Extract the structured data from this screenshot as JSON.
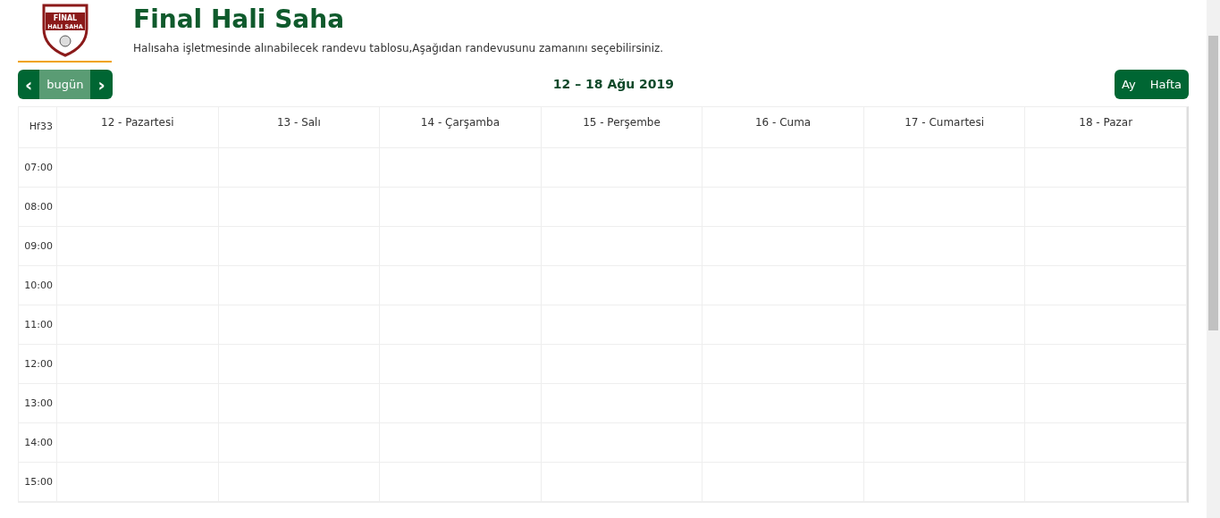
{
  "logo": {
    "line_1": "FİNAL",
    "line_2": "HALI SAHA"
  },
  "title": "Final Hali Saha",
  "subtitle": "Halısaha işletmesinde alınabilecek randevu tablosu,Aşağıdan randevusunu zamanını seçebilirsiniz.",
  "toolbar": {
    "prev": "‹",
    "today": {
      "label": "bugün",
      "disabled": true
    },
    "next": "›",
    "range": "12 – 18 Ağu 2019",
    "views": [
      {
        "label": "Ay"
      },
      {
        "label": "Hafta"
      }
    ]
  },
  "calendar": {
    "week": "Hf33",
    "days": [
      "12 - Pazartesi",
      "13 - Salı",
      "14 - Çarşamba",
      "15 - Perşembe",
      "16 - Cuma",
      "17 - Cumartesi",
      "18 - Pazar"
    ],
    "times": [
      "07:00",
      "08:00",
      "09:00",
      "10:00",
      "11:00",
      "12:00",
      "13:00",
      "14:00",
      "15:00"
    ]
  }
}
